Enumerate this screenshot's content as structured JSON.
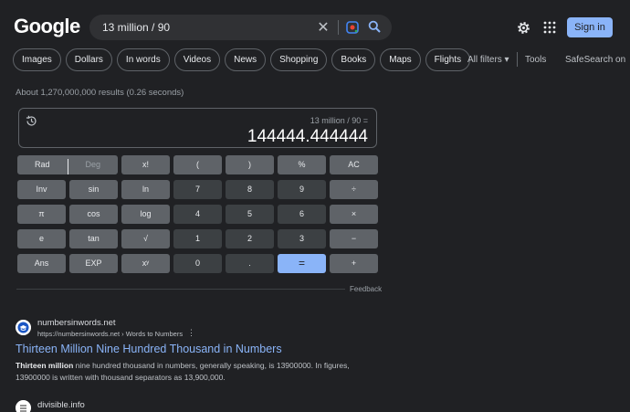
{
  "header": {
    "logo": "Google",
    "search_value": "13 million / 90",
    "signin_label": "Sign in"
  },
  "chips": [
    "Images",
    "Dollars",
    "In words",
    "Videos",
    "News",
    "Shopping",
    "Books",
    "Maps",
    "Flights"
  ],
  "tools": {
    "all_filters": "All filters ▾",
    "tools": "Tools",
    "safesearch": "SafeSearch on"
  },
  "stats": "About 1,270,000,000 results (0.26 seconds)",
  "calculator": {
    "expression": "13 million / 90 =",
    "result": "144444.444444",
    "rad": "Rad",
    "deg": "Deg",
    "keys": [
      [
        "x!",
        "(",
        ")",
        "%",
        "AC"
      ],
      [
        "Inv",
        "sin",
        "ln",
        "7",
        "8",
        "9",
        "÷"
      ],
      [
        "π",
        "cos",
        "log",
        "4",
        "5",
        "6",
        "×"
      ],
      [
        "e",
        "tan",
        "√",
        "1",
        "2",
        "3",
        "−"
      ],
      [
        "Ans",
        "EXP",
        "xʸ",
        "0",
        ".",
        "=",
        "+"
      ]
    ],
    "feedback": "Feedback"
  },
  "results": [
    {
      "site": "numbersinwords.net",
      "url": "https://numbersinwords.net › Words to Numbers",
      "title": "Thirteen Million Nine Hundred Thousand in Numbers",
      "snippet_bold": "Thirteen million",
      "snippet_rest": " nine hundred thousand in numbers, generally speaking, is 13900000. In figures, 13900000 is written with thousand separators as 13,900,000."
    },
    {
      "site": "divisible.info"
    }
  ]
}
